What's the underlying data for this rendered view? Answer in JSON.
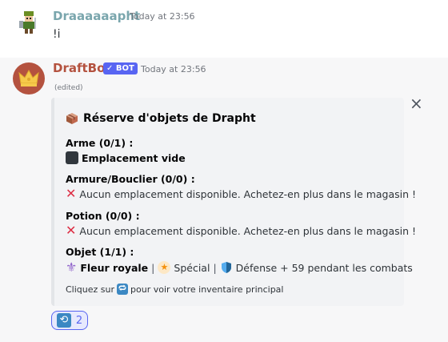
{
  "message1": {
    "author": "Draaaaaapht",
    "timestamp": "Today at 23:56",
    "content": "!i",
    "avatar_icon": "pixel-knight-avatar"
  },
  "message2": {
    "author": "DraftBot",
    "bot_tag": "✓ BOT",
    "timestamp": "Today at 23:56",
    "edited": "(edited)",
    "avatar_icon": "crown-avatar",
    "embed": {
      "close_icon": "×",
      "title_icon": "package-icon",
      "title": "Réserve d'objets de Drapht",
      "fields": [
        {
          "name": "Arme (0/1) :",
          "value_icon": "black-square-icon",
          "value": "Emplacement vide"
        },
        {
          "name": "Armure/Bouclier (0/0) :",
          "value_icon": "cross-mark-icon",
          "value": "Aucun emplacement disponible. Achetez-en plus dans le magasin !"
        },
        {
          "name": "Potion (0/0) :",
          "value_icon": "cross-mark-icon",
          "value": "Aucun emplacement disponible. Achetez-en plus dans le magasin !"
        },
        {
          "name": "Objet (1/1) :",
          "item_name": "Fleur royale",
          "separator": "|",
          "rarity": "Spécial",
          "effect": "Défense + 59 pendant les combats"
        }
      ],
      "footer_before": "Cliquez sur",
      "footer_after": "pour voir votre inventaire principal",
      "footer_icon": "repeat-icon"
    },
    "reaction": {
      "emoji_icon": "repeat-icon",
      "count": "2"
    }
  },
  "colors": {
    "author1": "#7aa6ad",
    "author2": "#b4523f",
    "bot_tag_bg": "#5865f2",
    "embed_bg": "#f2f3f5",
    "cross_red": "#dd2e44"
  }
}
